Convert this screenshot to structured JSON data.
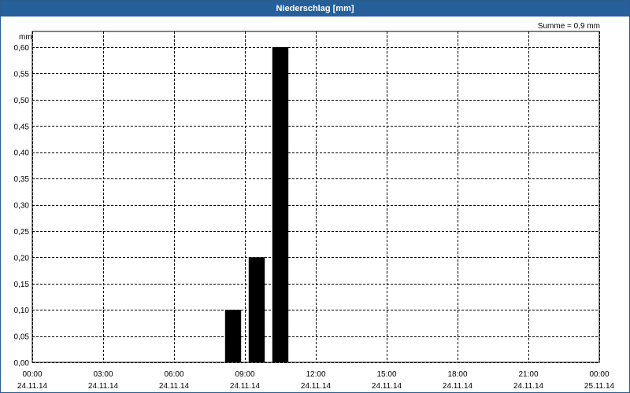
{
  "window": {
    "title": "Niederschlag [mm]"
  },
  "chart_data": {
    "type": "bar",
    "title": "Niederschlag [mm]",
    "annotation": "Summe = 0,9 mm",
    "ylabel": "mm",
    "ylim": [
      0,
      0.63
    ],
    "yticks": [
      "0,00",
      "0,05",
      "0,10",
      "0,15",
      "0,20",
      "0,25",
      "0,30",
      "0,35",
      "0,40",
      "0,45",
      "0,50",
      "0,55",
      "0,60"
    ],
    "xlim_hours": [
      0,
      24
    ],
    "xticks": [
      {
        "time": "00:00",
        "date": "24.11.14"
      },
      {
        "time": "03:00",
        "date": "24.11.14"
      },
      {
        "time": "06:00",
        "date": "24.11.14"
      },
      {
        "time": "09:00",
        "date": "24.11.14"
      },
      {
        "time": "12:00",
        "date": "24.11.14"
      },
      {
        "time": "15:00",
        "date": "24.11.14"
      },
      {
        "time": "18:00",
        "date": "24.11.14"
      },
      {
        "time": "21:00",
        "date": "24.11.14"
      },
      {
        "time": "00:00",
        "date": "25.11.14"
      }
    ],
    "bars": [
      {
        "x": "08:00-09:00",
        "value": 0.1
      },
      {
        "x": "09:00-10:00",
        "value": 0.2
      },
      {
        "x": "10:00-11:00",
        "value": 0.6
      }
    ],
    "bar_color": "#000000",
    "grid": true,
    "grid_style": "dashed"
  }
}
